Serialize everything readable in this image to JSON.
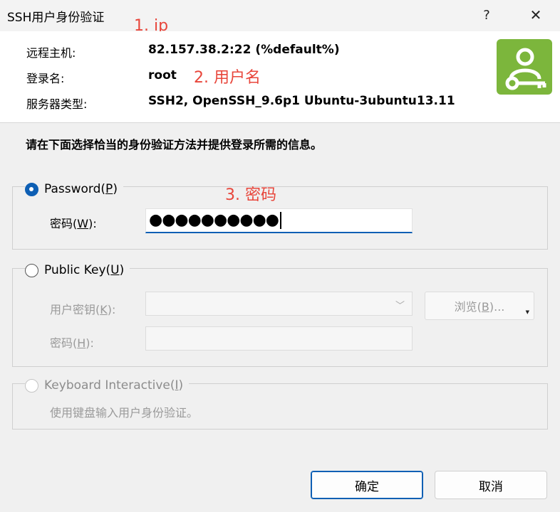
{
  "window": {
    "title": "SSH用户身份验证",
    "help_label": "?",
    "close_label": "✕"
  },
  "info": {
    "host_label": "远程主机:",
    "host_value": "82.157.38.2:22 (%default%)",
    "login_label": "登录名:",
    "login_value": "root",
    "server_type_label": "服务器类型:",
    "server_type_value": "SSH2, OpenSSH_9.6p1 Ubuntu-3ubuntu13.11",
    "badge_icon": "user-key-icon"
  },
  "annotations": {
    "note1": "1. ip",
    "note2": "2. 用户名",
    "note3": "3. 密码"
  },
  "instruction": "请在下面选择恰当的身份验证方法并提供登录所需的信息。",
  "password_group": {
    "legend_pre": "Password(",
    "legend_key": "P",
    "legend_post": ")",
    "selected": true,
    "field_label_pre": "密码(",
    "field_label_key": "W",
    "field_label_post": "):",
    "field_value": "●●●●●●●●●●"
  },
  "publickey_group": {
    "legend_pre": "Public Key(",
    "legend_key": "U",
    "legend_post": ")",
    "selected": false,
    "userkey_label_pre": "用户密钥(",
    "userkey_label_key": "K",
    "userkey_label_post": "):",
    "userkey_value": "",
    "passphrase_label_pre": "密码(",
    "passphrase_label_key": "H",
    "passphrase_label_post": "):",
    "passphrase_value": "",
    "browse_pre": "浏览(",
    "browse_key": "B",
    "browse_post": ")...",
    "enabled": false
  },
  "keyboard_group": {
    "legend_pre": "Keyboard Interactive(",
    "legend_key": "I",
    "legend_post": ")",
    "selected": false,
    "enabled": false,
    "description": "使用键盘输入用户身份验证。"
  },
  "buttons": {
    "ok": "确定",
    "cancel": "取消"
  },
  "colors": {
    "accent": "#0e5fb4",
    "badge": "#7cb63c",
    "annotation": "#e8463b"
  }
}
